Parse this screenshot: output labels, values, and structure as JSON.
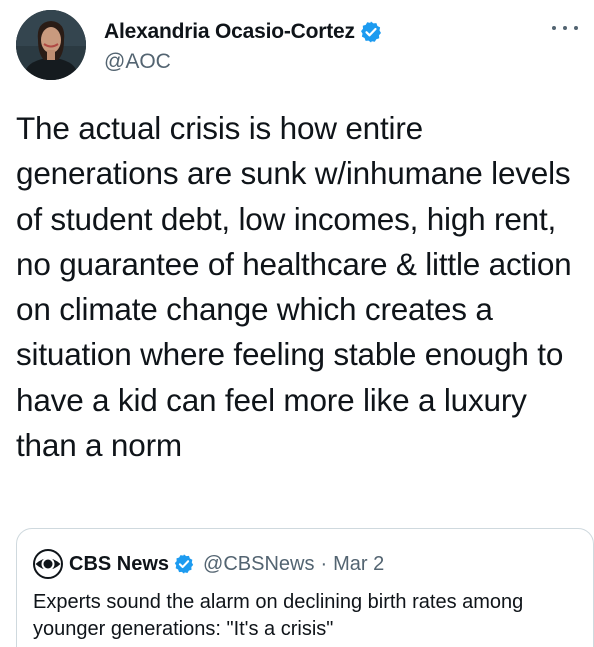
{
  "author": {
    "display_name": "Alexandria Ocasio-Cortez",
    "handle": "@AOC",
    "verified": true,
    "avatar_icon": "profile-photo"
  },
  "menu": {
    "icon": "more-dots-icon"
  },
  "tweet": {
    "text": "The actual crisis is how entire generations are sunk w/inhumane levels of student debt, low incomes, high rent, no guarantee of healthcare & little action on climate change which creates a situation where feeling stable enough to have a kid can feel more like a luxury than a norm"
  },
  "quoted_tweet": {
    "display_name": "CBS News",
    "handle": "@CBSNews",
    "separator": "·",
    "date": "Mar 2",
    "verified": true,
    "logo_icon": "cbs-eye-logo",
    "text": "Experts sound the alarm on declining birth rates among younger generations: \"It's a crisis\""
  },
  "colors": {
    "text_primary": "#0f1419",
    "text_secondary": "#536471",
    "verified_blue": "#1d9bf0",
    "border": "#cfd9de"
  }
}
